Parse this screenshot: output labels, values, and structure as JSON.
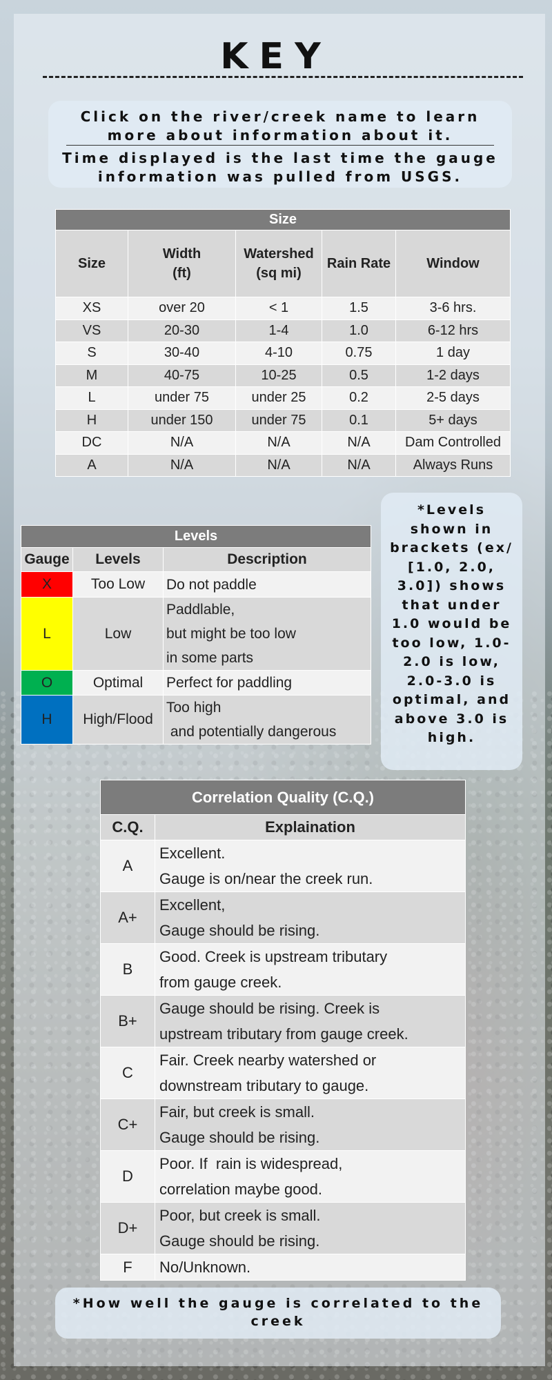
{
  "title": "KEY",
  "intro": {
    "line1": "Click on the river/creek name to learn more about information about it.",
    "line2": "Time displayed is the last time the gauge information was pulled from USGS."
  },
  "size_table": {
    "title": "Size",
    "columns": [
      "Size",
      "Width (ft)",
      "Watershed (sq mi)",
      "Rain Rate",
      "Window"
    ],
    "rows": [
      [
        "XS",
        "over 20",
        "< 1",
        "1.5",
        "3-6 hrs."
      ],
      [
        "VS",
        "20-30",
        "1-4",
        "1.0",
        "6-12 hrs"
      ],
      [
        "S",
        "30-40",
        "4-10",
        "0.75",
        "1 day"
      ],
      [
        "M",
        "40-75",
        "10-25",
        "0.5",
        "1-2 days"
      ],
      [
        "L",
        "under 75",
        "under 25",
        "0.2",
        "2-5 days"
      ],
      [
        "H",
        "under 150",
        "under 75",
        "0.1",
        "5+ days"
      ],
      [
        "DC",
        "N/A",
        "N/A",
        "N/A",
        "Dam Controlled"
      ],
      [
        "A",
        "N/A",
        "N/A",
        "N/A",
        "Always Runs"
      ]
    ]
  },
  "levels_table": {
    "title": "Levels",
    "columns": [
      "Gauge",
      "Levels",
      "Description"
    ],
    "rows": [
      {
        "gauge": "X",
        "color": "#ff0000",
        "level": "Too Low",
        "desc": [
          "Do not paddle"
        ]
      },
      {
        "gauge": "L",
        "color": "#ffff00",
        "level": "Low",
        "desc": [
          "Paddlable,",
          "but might be too low",
          "in some parts"
        ]
      },
      {
        "gauge": "O",
        "color": "#00b050",
        "level": "Optimal",
        "desc": [
          "Perfect for paddling"
        ]
      },
      {
        "gauge": "H",
        "color": "#0070c0",
        "level": "High/Flood",
        "desc": [
          "Too high",
          " and potentially dangerous"
        ]
      }
    ]
  },
  "levels_note": "*Levels shown in brackets (ex/ [1.0, 2.0, 3.0]) shows that under 1.0 would be too low, 1.0-2.0 is low, 2.0-3.0 is optimal, and above 3.0 is high.",
  "cq_table": {
    "title": "Correlation Quality (C.Q.)",
    "columns": [
      "C.Q.",
      "Explaination"
    ],
    "rows": [
      {
        "cq": "A",
        "exp": [
          "Excellent.",
          "Gauge is on/near the creek run."
        ]
      },
      {
        "cq": "A+",
        "exp": [
          "Excellent,",
          "Gauge should be rising."
        ]
      },
      {
        "cq": "B",
        "exp": [
          "Good. Creek is upstream tributary",
          "from gauge creek."
        ]
      },
      {
        "cq": "B+",
        "exp": [
          "Gauge should be rising. Creek is",
          "upstream tributary from gauge creek."
        ]
      },
      {
        "cq": "C",
        "exp": [
          "Fair. Creek nearby watershed or",
          "downstream tributary to gauge."
        ]
      },
      {
        "cq": "C+",
        "exp": [
          "Fair, but creek is small.",
          "Gauge should be rising."
        ]
      },
      {
        "cq": "D",
        "exp": [
          "Poor. If  rain is widespread,",
          "correlation maybe good."
        ]
      },
      {
        "cq": "D+",
        "exp": [
          "Poor, but creek is small.",
          "Gauge should be rising."
        ]
      },
      {
        "cq": "F",
        "exp": [
          "No/Unknown."
        ]
      }
    ]
  },
  "cq_note": "*How well the gauge is correlated to the creek"
}
